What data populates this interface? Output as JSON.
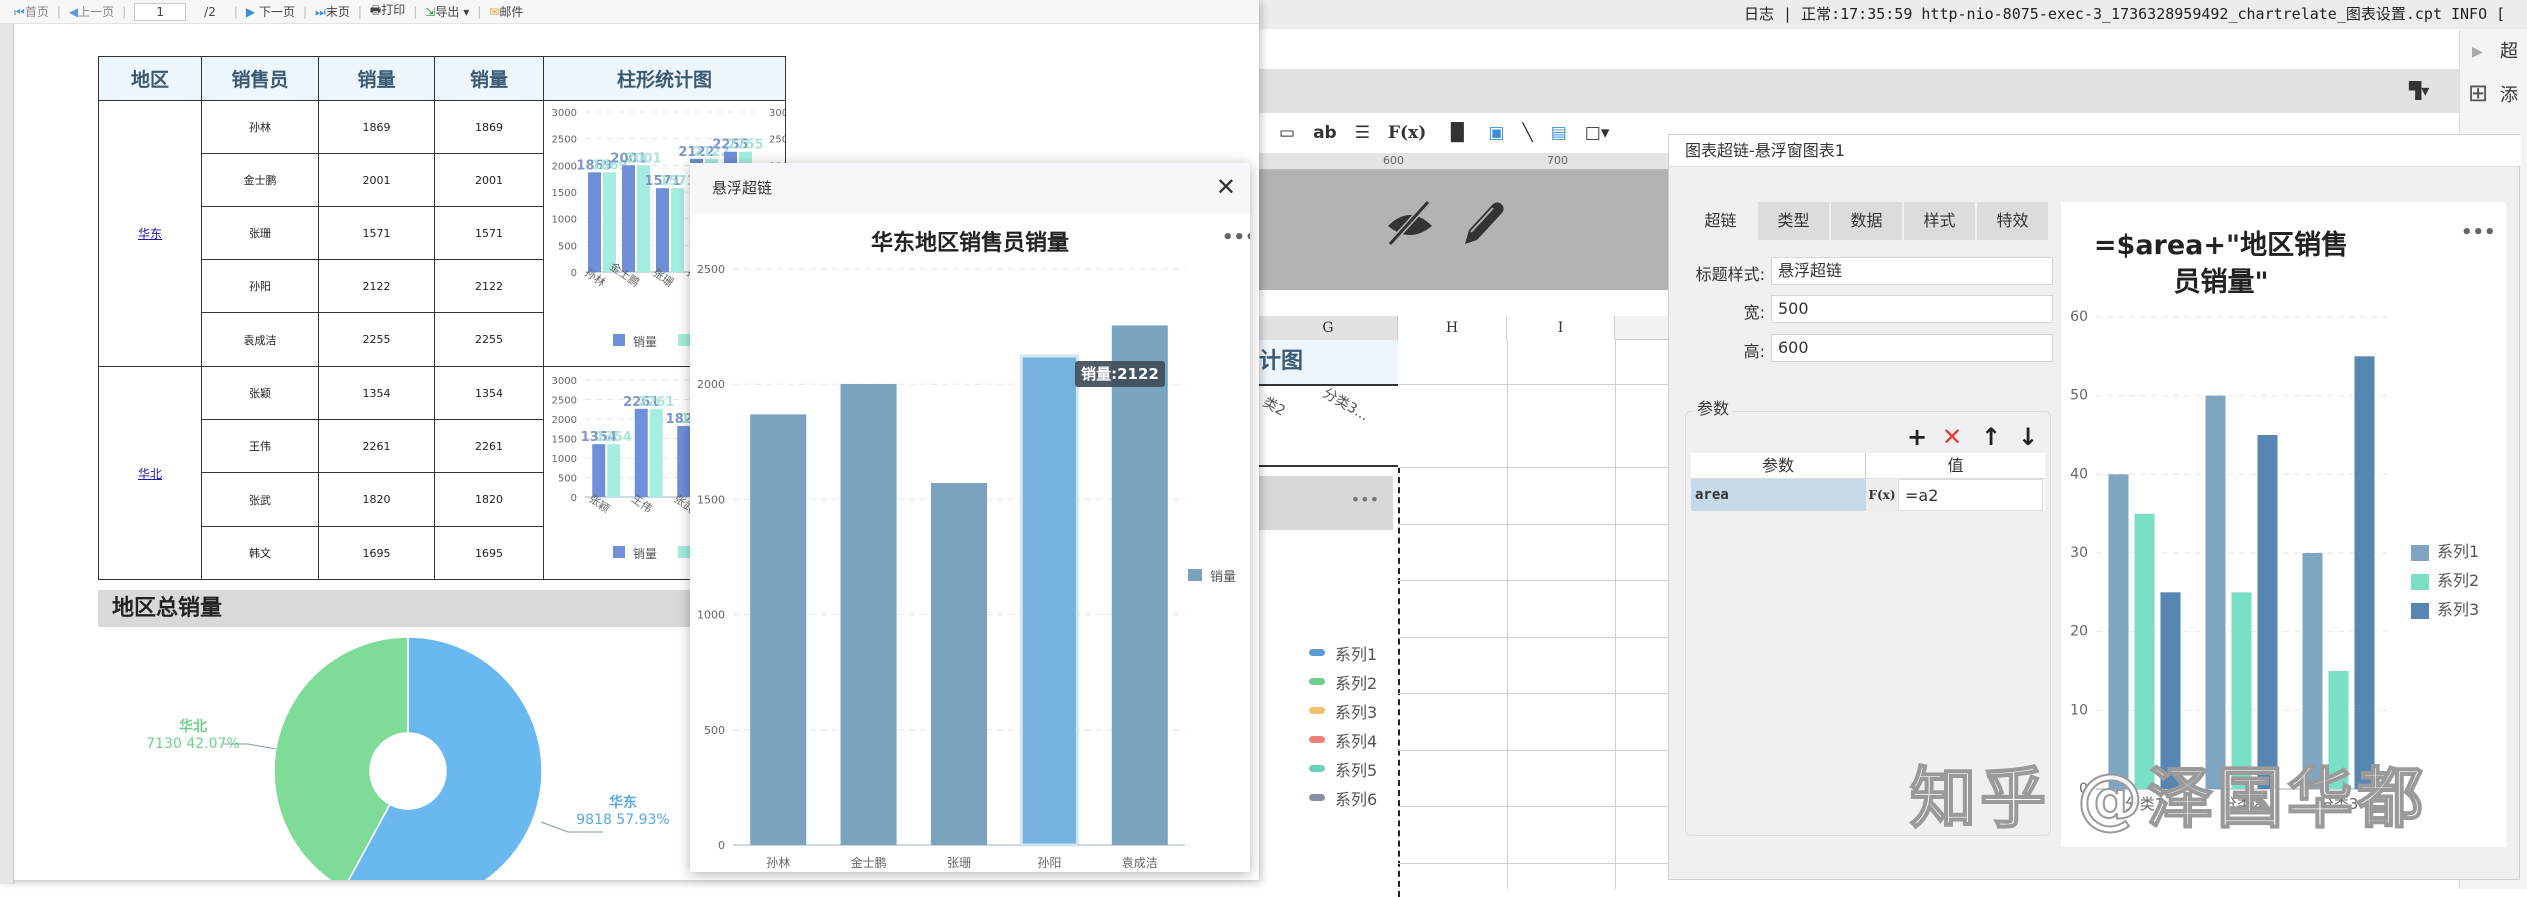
{
  "toolbar": {
    "first": "首页",
    "prev": "上一页",
    "page": "1",
    "total": "/2",
    "next": "下一页",
    "last": "末页",
    "print": "打印",
    "export": "导出",
    "mail": "邮件"
  },
  "table": {
    "headers": [
      "地区",
      "销售员",
      "销量",
      "销量",
      "柱形统计图"
    ],
    "groups": [
      {
        "region": "华东",
        "rows": [
          [
            "孙林",
            "1869",
            "1869"
          ],
          [
            "金士鹏",
            "2001",
            "2001"
          ],
          [
            "张珊",
            "1571",
            "1571"
          ],
          [
            "孙阳",
            "2122",
            "2122"
          ],
          [
            "袁成洁",
            "2255",
            "2255"
          ]
        ]
      },
      {
        "region": "华北",
        "rows": [
          [
            "张颖",
            "1354",
            "1354"
          ],
          [
            "王伟",
            "2261",
            "2261"
          ],
          [
            "张武",
            "1820",
            "1820"
          ],
          [
            "韩文",
            "1695",
            "1695"
          ]
        ]
      }
    ]
  },
  "pie_section": {
    "title": "地区总销量"
  },
  "popup": {
    "title": "悬浮超链",
    "tooltip": "销量:2122",
    "more": "•••"
  },
  "editor": {
    "log": "日志 | 正常:17:35:59 http-nio-8075-exec-3_1736328959492_chartrelate_图表设置.cpt INFO [",
    "ruler": [
      "600",
      "700"
    ],
    "columns": [
      "G",
      "H",
      "I"
    ],
    "cell_title": "计图",
    "cell_categories": [
      "类2",
      "分类3..."
    ],
    "more": "•••",
    "legend": [
      {
        "label": "系列1",
        "color": "#5b9bd5"
      },
      {
        "label": "系列2",
        "color": "#6fcf8a"
      },
      {
        "label": "系列3",
        "color": "#f2c26b"
      },
      {
        "label": "系列4",
        "color": "#ef7f77"
      },
      {
        "label": "系列5",
        "color": "#6ad0c0"
      },
      {
        "label": "系列6",
        "color": "#8a8fa8"
      }
    ],
    "side_tabs": [
      "超",
      "添"
    ]
  },
  "dialog": {
    "title": "图表超链-悬浮窗图表1",
    "tabs": [
      "超链",
      "类型",
      "数据",
      "样式",
      "特效"
    ],
    "fields": [
      {
        "label": "标题样式:",
        "value": "悬浮超链"
      },
      {
        "label": "宽:",
        "value": "500"
      },
      {
        "label": "高:",
        "value": "600"
      }
    ],
    "params_group": "参数",
    "param_headers": [
      "参数",
      "值"
    ],
    "params": [
      {
        "name": "area",
        "fx": "F(x)",
        "value": "=a2"
      }
    ]
  },
  "watermark": "知乎 @泽国华都",
  "chart_data": [
    {
      "id": "mini1",
      "type": "bar",
      "categories": [
        "孙林",
        "金士鹏",
        "张珊",
        "孙阳",
        "袁成洁"
      ],
      "series": [
        {
          "name": "销量",
          "values": [
            1869,
            2001,
            1571,
            2122,
            2255
          ],
          "color": "#6f8fd8"
        },
        {
          "name": "销量",
          "values": [
            1869,
            2001,
            1571,
            2122,
            2255
          ],
          "color": "#a3eee0"
        }
      ],
      "ylim": [
        0,
        3000
      ],
      "yticks": [
        "0",
        "500",
        "1000",
        "1500",
        "2000",
        "2500",
        "3000"
      ],
      "legend": "bottom"
    },
    {
      "id": "mini2",
      "type": "bar",
      "categories": [
        "张颖",
        "王伟",
        "张武",
        "韩文"
      ],
      "series": [
        {
          "name": "销量",
          "values": [
            1354,
            2261,
            1820,
            1695
          ],
          "color": "#6f8fd8"
        },
        {
          "name": "销量",
          "values": [
            1354,
            2261,
            1820,
            1695
          ],
          "color": "#a3eee0"
        }
      ],
      "ylim": [
        0,
        3000
      ],
      "yticks": [
        "0",
        "500",
        "1000",
        "1500",
        "2000",
        "2500",
        "3000"
      ],
      "legend": "bottom"
    },
    {
      "id": "popup",
      "type": "bar",
      "title": "华东地区销售员销量",
      "categories": [
        "孙林",
        "金士鹏",
        "张珊",
        "孙阳",
        "袁成洁"
      ],
      "series": [
        {
          "name": "销量",
          "values": [
            1869,
            2001,
            1571,
            2122,
            2255
          ],
          "color": "#7aa3bf"
        }
      ],
      "highlight_index": 3,
      "ylim": [
        0,
        2500
      ],
      "yticks": [
        "0",
        "500",
        "1000",
        "1500",
        "2000",
        "2500"
      ],
      "legend": "right"
    },
    {
      "id": "pie",
      "type": "pie",
      "title": "地区总销量",
      "slices": [
        {
          "label": "华东",
          "value": 9818,
          "percent": "57.93%",
          "color": "#6ab8f0"
        },
        {
          "label": "华北",
          "value": 7130,
          "percent": "42.07%",
          "color": "#7edc98"
        }
      ]
    },
    {
      "id": "preview",
      "type": "bar",
      "title": [
        "=$area+\"地区销售",
        "员销量\""
      ],
      "categories": [
        "分类1",
        "分类2",
        "分类3"
      ],
      "series": [
        {
          "name": "系列1",
          "values": [
            40,
            50,
            30
          ],
          "color": "#7ea6c2"
        },
        {
          "name": "系列2",
          "values": [
            35,
            25,
            15
          ],
          "color": "#79dfc5"
        },
        {
          "name": "系列3",
          "values": [
            25,
            45,
            55
          ],
          "color": "#5686b1"
        }
      ],
      "ylim": [
        0,
        60
      ],
      "yticks": [
        "0",
        "10",
        "20",
        "30",
        "40",
        "50",
        "60"
      ],
      "legend": "right",
      "more": "•••"
    }
  ]
}
